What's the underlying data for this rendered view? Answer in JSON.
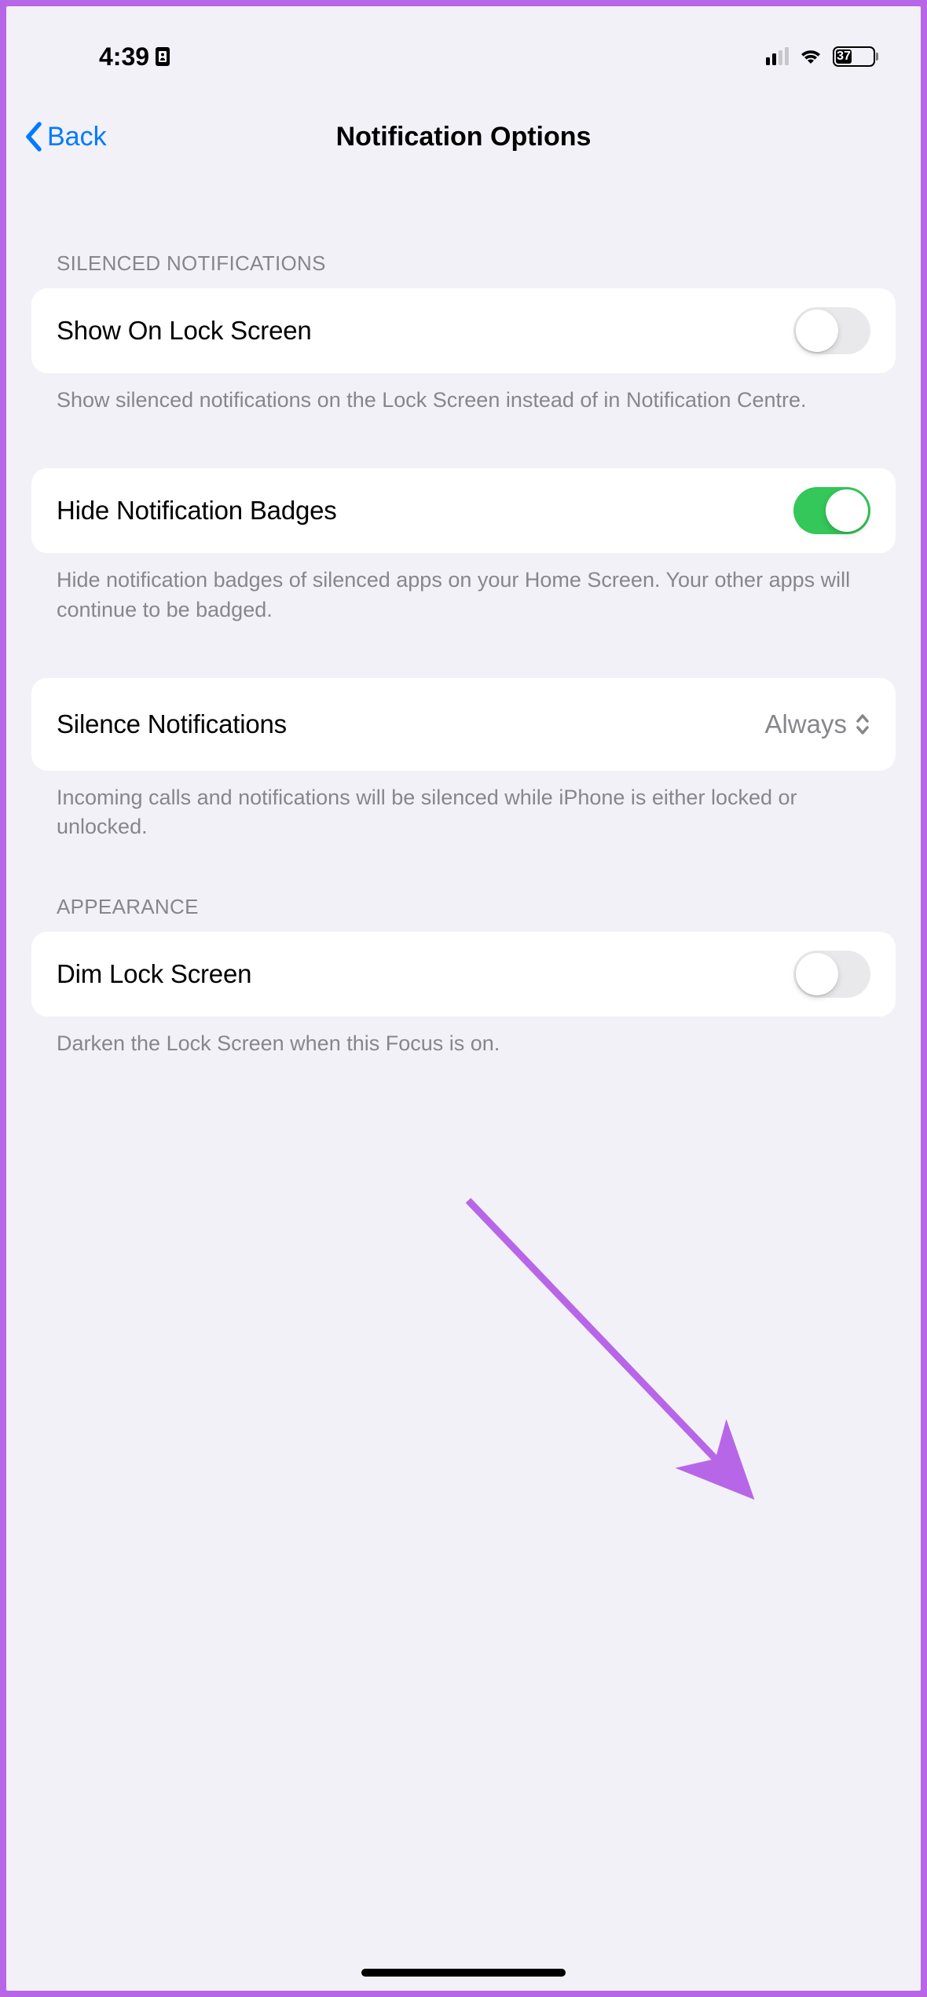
{
  "status": {
    "time": "4:39",
    "battery_percent": "37"
  },
  "nav": {
    "back_label": "Back",
    "title": "Notification Options"
  },
  "sections": {
    "silenced": {
      "header": "SILENCED NOTIFICATIONS",
      "show_on_lock": {
        "label": "Show On Lock Screen",
        "footer": "Show silenced notifications on the Lock Screen instead of in Notification Centre."
      },
      "hide_badges": {
        "label": "Hide Notification Badges",
        "footer": "Hide notification badges of silenced apps on your Home Screen. Your other apps will continue to be badged."
      },
      "silence_notifications": {
        "label": "Silence Notifications",
        "value": "Always",
        "footer": "Incoming calls and notifications will be silenced while iPhone is either locked or unlocked."
      }
    },
    "appearance": {
      "header": "APPEARANCE",
      "dim_lock_screen": {
        "label": "Dim Lock Screen",
        "footer": "Darken the Lock Screen when this Focus is on."
      }
    }
  }
}
